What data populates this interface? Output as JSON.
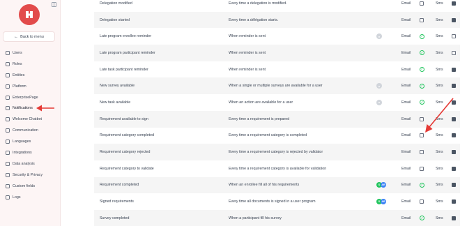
{
  "sidebar": {
    "back_label": "Back to menu",
    "items": [
      {
        "label": "Users",
        "icon": "users-icon"
      },
      {
        "label": "Roles",
        "icon": "roles-icon"
      },
      {
        "label": "Entities",
        "icon": "entities-icon"
      },
      {
        "label": "Platform",
        "icon": "platform-icon"
      },
      {
        "label": "EnterprisePage",
        "icon": "enterprise-page-icon"
      },
      {
        "label": "Notifications",
        "icon": "bell-icon"
      },
      {
        "label": "Welcome Chatbot",
        "icon": "chat-icon"
      },
      {
        "label": "Communication",
        "icon": "communication-icon"
      },
      {
        "label": "Languages",
        "icon": "language-icon"
      },
      {
        "label": "Integrations",
        "icon": "integrations-icon"
      },
      {
        "label": "Data analysis",
        "icon": "data-analysis-icon"
      },
      {
        "label": "Security & Privacy",
        "icon": "shield-icon"
      },
      {
        "label": "Custom fields",
        "icon": "custom-fields-icon"
      },
      {
        "label": "Logs",
        "icon": "logs-icon"
      }
    ]
  },
  "table": {
    "email_label": "Email",
    "sms_label": "Sms",
    "rows": [
      {
        "name": "Delegation modified",
        "description": "Every time a delegation is modified."
      },
      {
        "name": "Delegation started",
        "description": "Every time a délégation starts."
      },
      {
        "name": "Late program enrollee reminder",
        "description": "When reminder is sent"
      },
      {
        "name": "Late program participant reminder",
        "description": "When reminder is sent"
      },
      {
        "name": "Late task participant reminder",
        "description": "When reminder is sent"
      },
      {
        "name": "New survey available",
        "description": "When a single or multiple surveys are available for a user"
      },
      {
        "name": "New task available",
        "description": "When an action are available for a user"
      },
      {
        "name": "Requirement available to sign",
        "description": "Every time a requirement is prepared"
      },
      {
        "name": "Requirement category completed",
        "description": "Every time a requirement category is completed"
      },
      {
        "name": "Requirement category rejected",
        "description": "Every time a requirement category is rejected by validator"
      },
      {
        "name": "Requirement category to validate",
        "description": "Every time a requirement category is available for validation"
      },
      {
        "name": "Requirement completed",
        "description": "When an enrollee fill all of his requirements"
      },
      {
        "name": "Signed requirements",
        "description": "Every time all documents is signed in a user program"
      },
      {
        "name": "Survey completed",
        "description": "When a participant fill his survey"
      }
    ],
    "avatar_initials": [
      "S",
      "AR"
    ]
  },
  "colors": {
    "brand": "#e24b4b",
    "check_ok": "#22c55e",
    "arrow": "#e53935"
  }
}
